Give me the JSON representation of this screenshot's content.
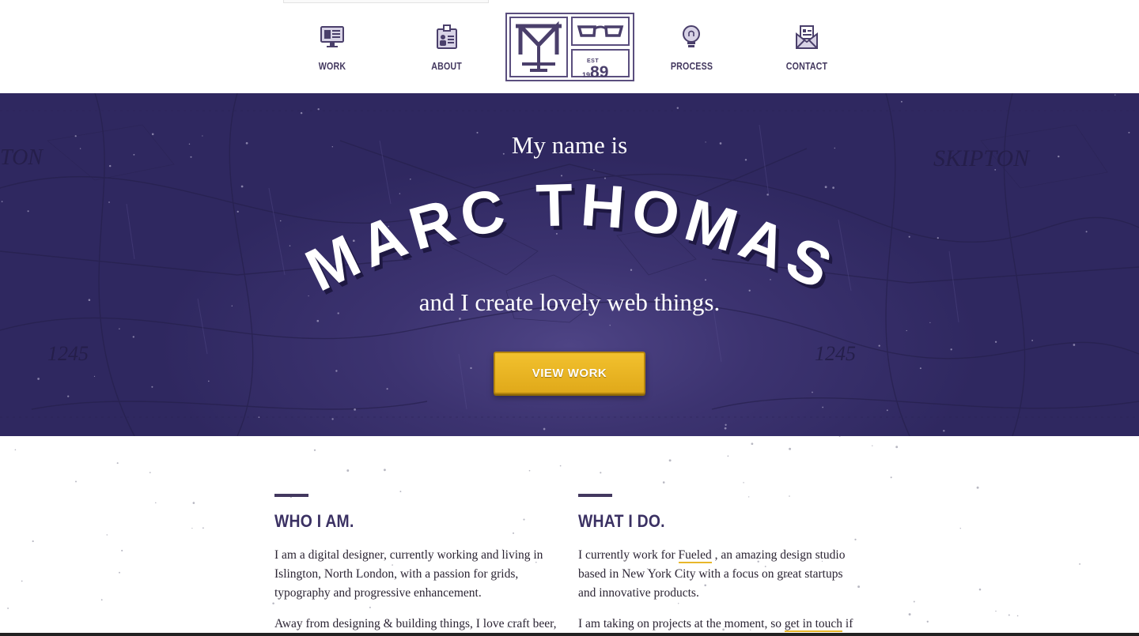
{
  "nav": {
    "items": [
      {
        "label": "WORK",
        "icon": "monitor-icon"
      },
      {
        "label": "ABOUT",
        "icon": "id-badge-icon"
      },
      {
        "label": "PROCESS",
        "icon": "lightbulb-icon"
      },
      {
        "label": "CONTACT",
        "icon": "envelope-icon"
      }
    ],
    "logo": {
      "monogram": "MT",
      "est": "EST",
      "year_small": "19",
      "year_big": "89"
    }
  },
  "hero": {
    "intro": "My name is",
    "name": "MARC THOMAS",
    "tagline": "and I create lovely web things.",
    "cta_label": "VIEW WORK",
    "map_labels": [
      "SKIPTON",
      "1245",
      "1245",
      "TON"
    ]
  },
  "who": {
    "heading": "WHO I AM.",
    "p1": "I am a digital designer, currently working and living in Islington, North London, with a passion for grids, typography and progressive enhancement.",
    "p2": "Away from designing & building things, I love craft beer,"
  },
  "what": {
    "heading": "WHAT I DO.",
    "p1_before": "I currently work for ",
    "p1_link": "Fueled",
    "p1_after": " , an amazing design studio based in New York City with a focus on great startups and innovative products.",
    "p2_before": "I am taking on projects at the moment, so ",
    "p2_link": "get in touch",
    "p2_after": " if"
  },
  "colors": {
    "brand_purple": "#3c3370",
    "accent_yellow": "#e8b72a",
    "nav_text": "#43385f"
  }
}
